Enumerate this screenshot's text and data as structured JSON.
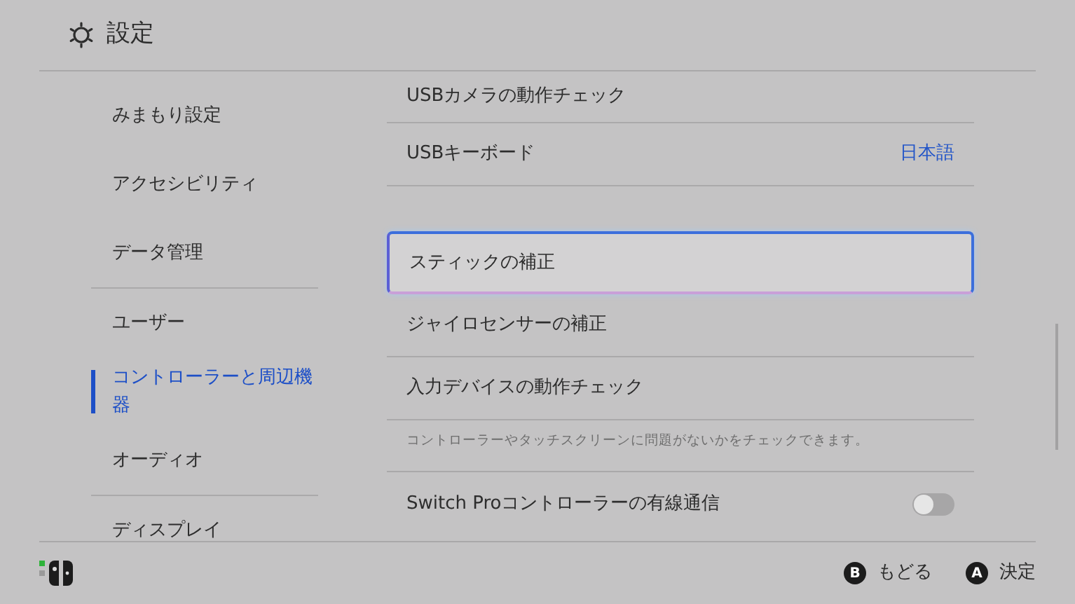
{
  "header": {
    "title": "設定"
  },
  "sidebar": {
    "groups": [
      [
        {
          "label": "みまもり設定",
          "selected": false
        },
        {
          "label": "アクセシビリティ",
          "selected": false
        },
        {
          "label": "データ管理",
          "selected": false
        }
      ],
      [
        {
          "label": "ユーザー",
          "selected": false
        },
        {
          "label": "コントローラーと周辺機器",
          "selected": true
        },
        {
          "label": "オーディオ",
          "selected": false
        }
      ],
      [
        {
          "label": "ディスプレイ",
          "selected": false
        }
      ]
    ]
  },
  "settings": {
    "groups": [
      [
        {
          "kind": "item",
          "label": "USBカメラの動作チェック",
          "selected": false
        },
        {
          "kind": "item",
          "label": "USBキーボード",
          "value": "日本語",
          "selected": false
        }
      ],
      [
        {
          "kind": "item",
          "label": "スティックの補正",
          "selected": true
        },
        {
          "kind": "item",
          "label": "ジャイロセンサーの補正",
          "selected": false
        },
        {
          "kind": "item",
          "label": "入力デバイスの動作チェック",
          "selected": false
        },
        {
          "kind": "description",
          "label": "コントローラーやタッチスクリーンに問題がないかをチェックできます。"
        }
      ],
      [
        {
          "kind": "toggle",
          "label": "Switch Proコントローラーの有線通信",
          "on": false
        }
      ]
    ]
  },
  "footer": {
    "actions": [
      {
        "button": "B",
        "label": "もどる"
      },
      {
        "button": "A",
        "label": "決定"
      }
    ]
  }
}
